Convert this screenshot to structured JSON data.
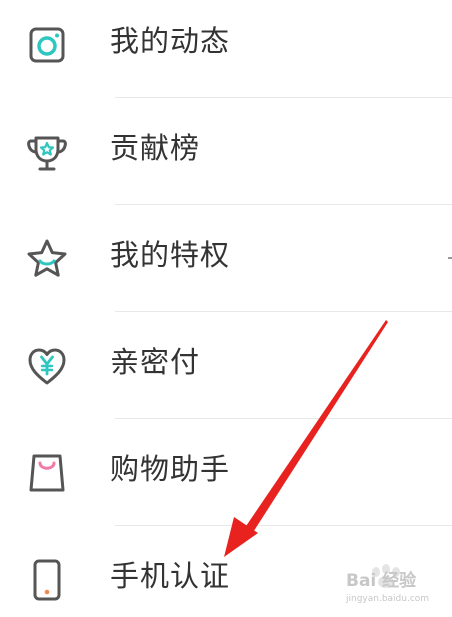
{
  "menu": {
    "items": [
      {
        "label": "我的动态",
        "icon": "camera-icon"
      },
      {
        "label": "贡献榜",
        "icon": "trophy-icon"
      },
      {
        "label": "我的特权",
        "icon": "star-icon"
      },
      {
        "label": "亲密付",
        "icon": "heart-yuan-icon"
      },
      {
        "label": "购物助手",
        "icon": "shopping-bag-icon"
      },
      {
        "label": "手机认证",
        "icon": "phone-icon"
      }
    ]
  },
  "colors": {
    "teal": "#2ec7c0",
    "pink": "#f07aa8",
    "orange": "#f08a4b",
    "icon_stroke": "#555555",
    "arrow": "#e8231f",
    "text": "#333333",
    "divider": "#e8e8e8"
  },
  "annotation": {
    "type": "red-arrow",
    "target_item": "手机认证"
  },
  "watermark": {
    "text": "Bai 经验",
    "url": "jingyan.baidu.com"
  }
}
